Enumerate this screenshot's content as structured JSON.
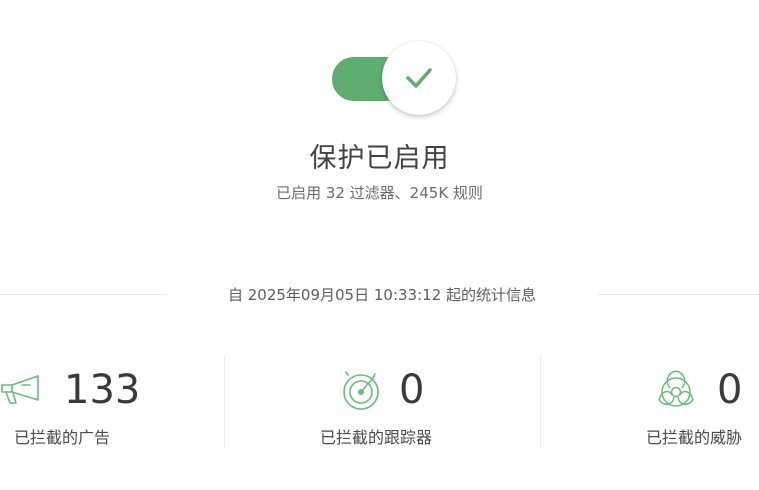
{
  "protection": {
    "enabled": true,
    "title": "保护已启用",
    "subtitle": "已启用 32 过滤器、245K 规则"
  },
  "stats": {
    "heading": "自 2025年09月05日 10:33:12 起的统计信息",
    "items": [
      {
        "icon": "megaphone-icon",
        "value": "133",
        "label": "已拦截的广告"
      },
      {
        "icon": "radar-icon",
        "value": "0",
        "label": "已拦截的跟踪器"
      },
      {
        "icon": "biohazard-icon",
        "value": "0",
        "label": "已拦截的威胁"
      }
    ]
  },
  "colors": {
    "accent": "#5fae6f",
    "icon": "#67bd7b"
  }
}
